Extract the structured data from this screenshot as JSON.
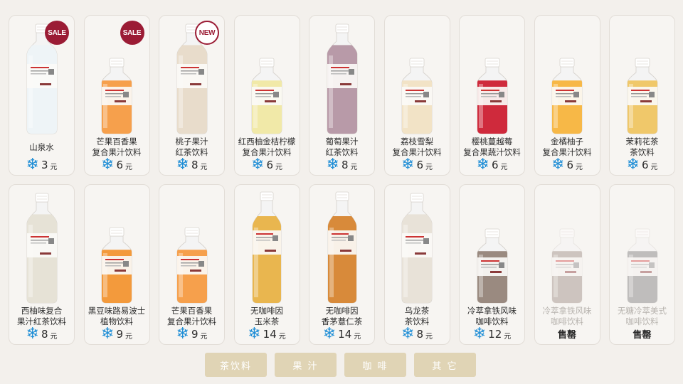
{
  "currency_unit": "元",
  "snow_icon": "snowflake-icon",
  "products": [
    {
      "name": "山泉水",
      "price": "3",
      "badge": "SALE",
      "liquid": "#eef4f7",
      "cap": "#ffffff",
      "shape": "tall",
      "fill": 0.96
    },
    {
      "name": "芒果百香果\n复合果汁饮料",
      "price": "6",
      "badge": "SALE",
      "liquid": "#f6a04c",
      "cap": "#ffffff",
      "shape": "short",
      "fill": 0.9
    },
    {
      "name": "桃子果汁\n红茶饮料",
      "price": "8",
      "badge": "NEW",
      "liquid": "#e8dccb",
      "cap": "#ffffff",
      "shape": "tall",
      "fill": 0.94
    },
    {
      "name": "红西柚金桔柠檬\n复合果汁饮料",
      "price": "6",
      "badge": "",
      "liquid": "#f1e9a8",
      "cap": "#ffffff",
      "shape": "short",
      "fill": 0.9
    },
    {
      "name": "葡萄果汁\n红茶饮料",
      "price": "8",
      "badge": "",
      "liquid": "#b89aa8",
      "cap": "#ffffff",
      "shape": "tall",
      "fill": 0.94
    },
    {
      "name": "荔枝雪梨\n复合果汁饮料",
      "price": "6",
      "badge": "",
      "liquid": "#f2e3c6",
      "cap": "#ffffff",
      "shape": "short",
      "fill": 0.9
    },
    {
      "name": "樱桃蔓越莓\n复合果蔬汁饮料",
      "price": "6",
      "badge": "",
      "liquid": "#cf2a3c",
      "cap": "#ffffff",
      "shape": "short",
      "fill": 0.9
    },
    {
      "name": "金橘柚子\n复合果汁饮料",
      "price": "6",
      "badge": "",
      "liquid": "#f7b847",
      "cap": "#ffffff",
      "shape": "short",
      "fill": 0.9
    },
    {
      "name": "茉莉花茶\n茶饮料",
      "price": "6",
      "badge": "",
      "liquid": "#f0c86a",
      "cap": "#ffffff",
      "shape": "short",
      "fill": 0.9
    },
    {
      "name": "西柚味复合\n果汁红茶饮料",
      "price": "8",
      "badge": "",
      "liquid": "#e6e2d6",
      "cap": "#ffffff",
      "shape": "tall",
      "fill": 0.94
    },
    {
      "name": "黑豆味路易波士\n植物饮料",
      "price": "9",
      "badge": "",
      "liquid": "#f39a3c",
      "cap": "#ffffff",
      "shape": "short",
      "fill": 0.9
    },
    {
      "name": "芒果百香果\n复合果汁饮料",
      "price": "9",
      "badge": "",
      "liquid": "#f6a04c",
      "cap": "#ffffff",
      "shape": "short",
      "fill": 0.9
    },
    {
      "name": "无咖啡因\n玉米茶",
      "price": "14",
      "badge": "",
      "liquid": "#e9b64f",
      "cap": "#ffffff",
      "shape": "tea",
      "fill": 0.92
    },
    {
      "name": "无咖啡因\n香茅薏仁茶",
      "price": "14",
      "badge": "",
      "liquid": "#d88a3a",
      "cap": "#ffffff",
      "shape": "tea",
      "fill": 0.92
    },
    {
      "name": "乌龙茶\n茶饮料",
      "price": "8",
      "badge": "",
      "liquid": "#e8e2d8",
      "cap": "#ffffff",
      "shape": "tall",
      "fill": 0.94
    },
    {
      "name": "冷萃拿铁风味\n咖啡饮料",
      "price": "12",
      "badge": "",
      "liquid": "#9a8a80",
      "cap": "#ffffff",
      "shape": "small",
      "fill": 0.85
    },
    {
      "name": "冷萃拿铁风味\n咖啡饮料",
      "price": "",
      "badge": "",
      "liquid": "#9a8a80",
      "cap": "#ffffff",
      "shape": "small",
      "fill": 0.85,
      "soldout": "售罄"
    },
    {
      "name": "无糖冷萃美式\n咖啡饮料",
      "price": "",
      "badge": "",
      "liquid": "#7b7b7b",
      "cap": "#ffffff",
      "shape": "small",
      "fill": 0.85,
      "soldout": "售罄"
    }
  ],
  "tabs": [
    "茶饮料",
    "果 汁",
    "咖 啡",
    "其 它"
  ]
}
